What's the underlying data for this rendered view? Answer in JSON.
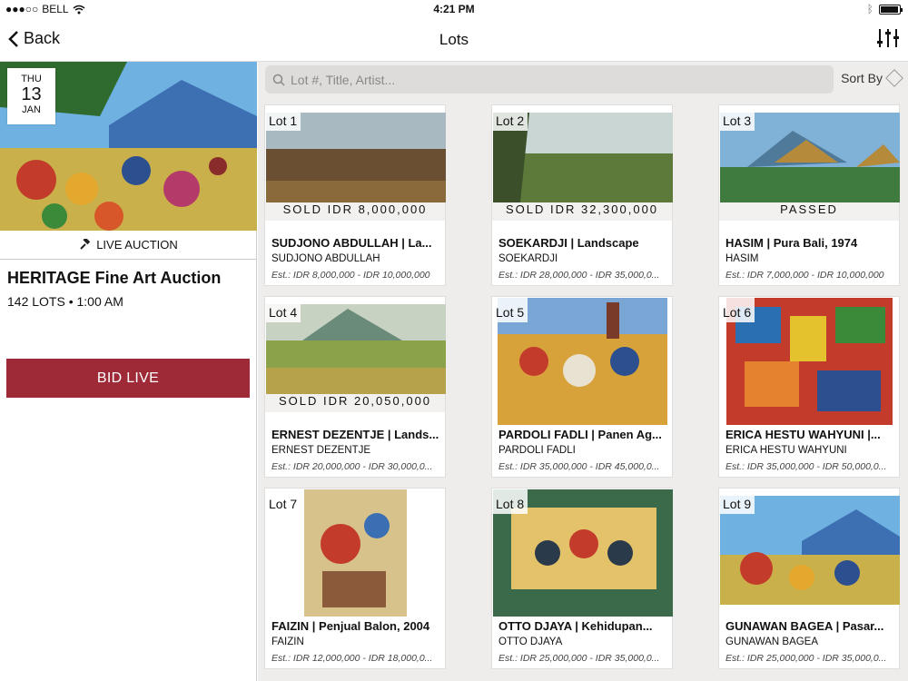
{
  "status_bar": {
    "carrier": "BELL",
    "time": "4:21 PM"
  },
  "navbar": {
    "back_label": "Back",
    "title": "Lots"
  },
  "auction": {
    "date_dow": "THU",
    "date_day": "13",
    "date_month": "JAN",
    "type_label": "LIVE AUCTION",
    "title": "HERITAGE Fine Art Auction",
    "meta": "142 LOTS • 1:00 AM",
    "bid_label": "BID LIVE"
  },
  "search": {
    "placeholder": "Lot #, Title, Artist...",
    "sort_label": "Sort By"
  },
  "lots": [
    {
      "lot": "Lot 1",
      "status": "SOLD IDR 8,000,000",
      "title": "SUDJONO ABDULLAH | La...",
      "artist": "SUDJONO ABDULLAH",
      "estimate": "Est.: IDR 8,000,000 - IDR 10,000,000"
    },
    {
      "lot": "Lot 2",
      "status": "SOLD IDR 32,300,000",
      "title": "SOEKARDJI | Landscape",
      "artist": "SOEKARDJI",
      "estimate": "Est.: IDR 28,000,000 - IDR 35,000,0..."
    },
    {
      "lot": "Lot 3",
      "status": "PASSED",
      "title": "HASIM | Pura Bali, 1974",
      "artist": "HASIM",
      "estimate": "Est.: IDR 7,000,000 - IDR 10,000,000"
    },
    {
      "lot": "Lot 4",
      "status": "SOLD IDR 20,050,000",
      "title": "ERNEST DEZENTJE | Lands...",
      "artist": "ERNEST DEZENTJE",
      "estimate": "Est.: IDR 20,000,000 - IDR 30,000,0..."
    },
    {
      "lot": "Lot 5",
      "status": "",
      "title": "PARDOLI FADLI | Panen Ag...",
      "artist": "PARDOLI FADLI",
      "estimate": "Est.: IDR 35,000,000 - IDR 45,000,0..."
    },
    {
      "lot": "Lot 6",
      "status": "",
      "title": "ERICA HESTU WAHYUNI |...",
      "artist": "ERICA HESTU WAHYUNI",
      "estimate": "Est.: IDR 35,000,000 - IDR 50,000,0..."
    },
    {
      "lot": "Lot 7",
      "status": "",
      "title": "FAIZIN | Penjual Balon, 2004",
      "artist": "FAIZIN",
      "estimate": "Est.: IDR 12,000,000 - IDR 18,000,0..."
    },
    {
      "lot": "Lot 8",
      "status": "",
      "title": "OTTO DJAYA | Kehidupan...",
      "artist": "OTTO DJAYA",
      "estimate": "Est.: IDR 25,000,000 - IDR 35,000,0..."
    },
    {
      "lot": "Lot 9",
      "status": "",
      "title": "GUNAWAN BAGEA | Pasar...",
      "artist": "GUNAWAN BAGEA",
      "estimate": "Est.: IDR 25,000,000 - IDR 35,000,0..."
    }
  ],
  "colors": {
    "accent": "#9e2a37",
    "background": "#efedeb"
  }
}
